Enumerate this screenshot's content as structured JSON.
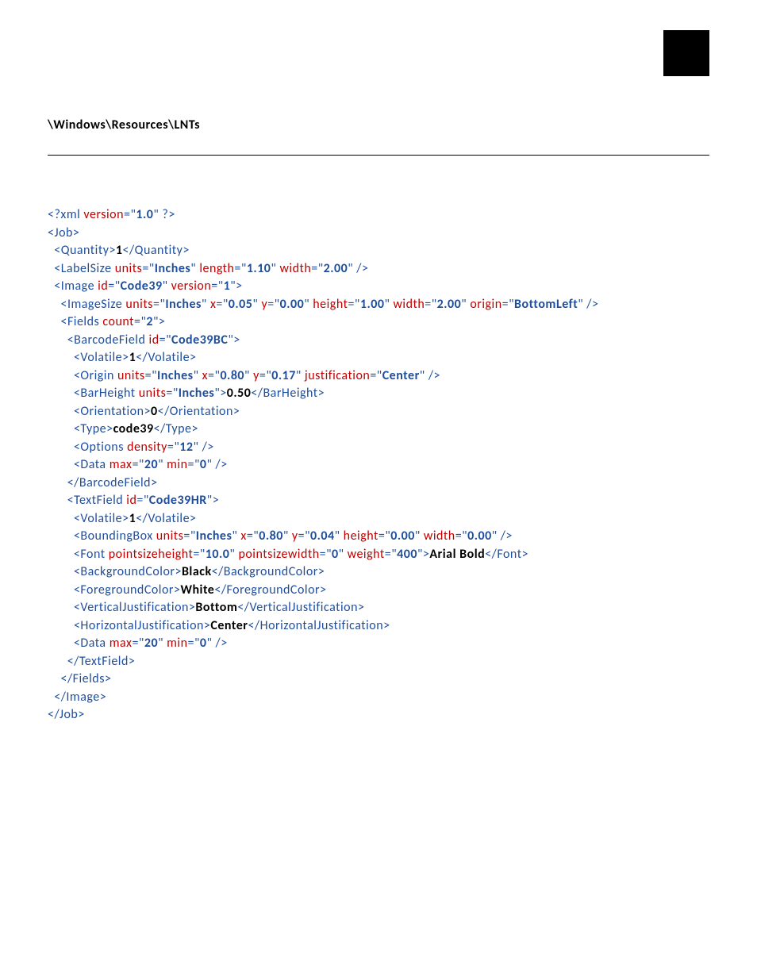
{
  "header": "\\Windows\\Resources\\LNTs",
  "xml": {
    "version_attr": "version",
    "version_val": "1.0",
    "root": "Job",
    "quantity_tag": "Quantity",
    "quantity_val": "1",
    "labelsize_tag": "LabelSize",
    "units_attr": "units",
    "inches": "Inches",
    "length_attr": "length",
    "length_val": "1.10",
    "width_attr": "width",
    "width_val": "2.00",
    "image_tag": "Image",
    "id_attr": "id",
    "image_id": "Code39",
    "version2_attr": "version",
    "version2_val": "1",
    "imagesize_tag": "ImageSize",
    "x_attr": "x",
    "y_attr": "y",
    "height_attr": "height",
    "im_x": "0.05",
    "im_y": "0.00",
    "im_h": "1.00",
    "im_w": "2.00",
    "origin_attr": "origin",
    "origin_val": "BottomLeft",
    "fields_tag": "Fields",
    "count_attr": "count",
    "count_val": "2",
    "bcf_tag": "BarcodeField",
    "bcf_id": "Code39BC",
    "volatile_tag": "Volatile",
    "volatile_val": "1",
    "origin_tag": "Origin",
    "bcf_ox": "0.80",
    "bcf_oy": "0.17",
    "just_attr": "justification",
    "center": "Center",
    "barheight_tag": "BarHeight",
    "barheight_val": "0.50",
    "orient_tag": "Orientation",
    "orient_val": "0",
    "type_tag": "Type",
    "type_val": "code39",
    "options_tag": "Options",
    "density_attr": "density",
    "density_val": "12",
    "data_tag": "Data",
    "max_attr": "max",
    "min_attr": "min",
    "max_val": "20",
    "min_val": "0",
    "tf_tag": "TextField",
    "tf_id": "Code39HR",
    "bb_tag": "BoundingBox",
    "bb_x": "0.80",
    "bb_y": "0.04",
    "bb_h": "0.00",
    "bb_w": "0.00",
    "font_tag": "Font",
    "psh_attr": "pointsizeheight",
    "psh_val": "10.0",
    "psw_attr": "pointsizewidth",
    "psw_val": "0",
    "weight_attr": "weight",
    "weight_val": "400",
    "font_val": "Arial Bold",
    "bgc_tag": "BackgroundColor",
    "bgc_val": "Black",
    "fgc_tag": "ForegroundColor",
    "fgc_val": "White",
    "vj_tag": "VerticalJustification",
    "vj_val": "Bottom",
    "hj_tag": "HorizontalJustification",
    "hj_val": "Center"
  }
}
